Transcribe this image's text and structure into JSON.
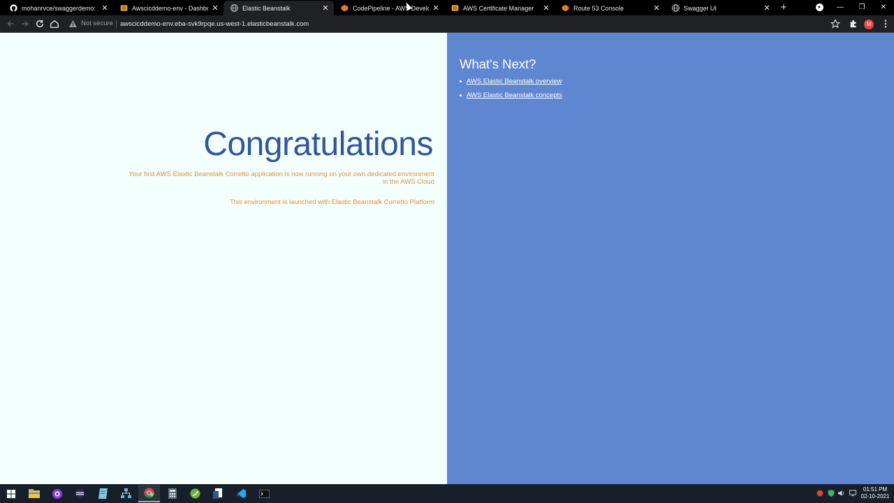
{
  "tabs": [
    {
      "title": "mohanrvce/swaggerdemo: swag",
      "favicon": "github-icon",
      "active": false
    },
    {
      "title": "Awscicddemo-env - Dashboard",
      "favicon": "aws-box-icon",
      "active": false
    },
    {
      "title": "Elastic Beanstalk",
      "favicon": "globe-icon",
      "active": true
    },
    {
      "title": "CodePipeline - AWS Developer T",
      "favicon": "aws-orange-icon",
      "active": false
    },
    {
      "title": "AWS Certificate Manager",
      "favicon": "aws-box-icon",
      "active": false
    },
    {
      "title": "Route 53 Console",
      "favicon": "aws-orange-icon",
      "active": false
    },
    {
      "title": "Swagger UI",
      "favicon": "globe-icon",
      "active": false
    }
  ],
  "toolbar": {
    "security_label": "Not secure",
    "url": "awscicddemo-env.eba-svk9rpqe.us-west-1.elasticbeanstalk.com",
    "profile_initial": "M"
  },
  "page": {
    "heading": "Congratulations",
    "paragraph1": "Your first AWS Elastic Beanstalk Corretto application is now running on your own dedicated environment in the AWS Cloud",
    "paragraph2": "This environment is launched with Elastic Beanstalk Corretto Platform",
    "next_title": "What's Next?",
    "links": [
      {
        "label": "AWS Elastic Beanstalk overview"
      },
      {
        "label": "AWS Elastic Beanstalk concepts"
      }
    ]
  },
  "taskbar": {
    "apps": [
      "windows-start-icon",
      "file-explorer-icon",
      "github-desktop-icon",
      "eclipse-icon",
      "notepad-icon",
      "network-icon",
      "chrome-icon",
      "calculator-icon",
      "spring-tools-icon",
      "document-icon",
      "vscode-icon",
      "terminal-icon"
    ],
    "time": "01:51 PM",
    "date": "02-10-2021"
  },
  "colors": {
    "left_bg": "#f2fffd",
    "right_bg": "#5f86d1",
    "heading": "#335599",
    "paragraph": "#e2923c"
  }
}
